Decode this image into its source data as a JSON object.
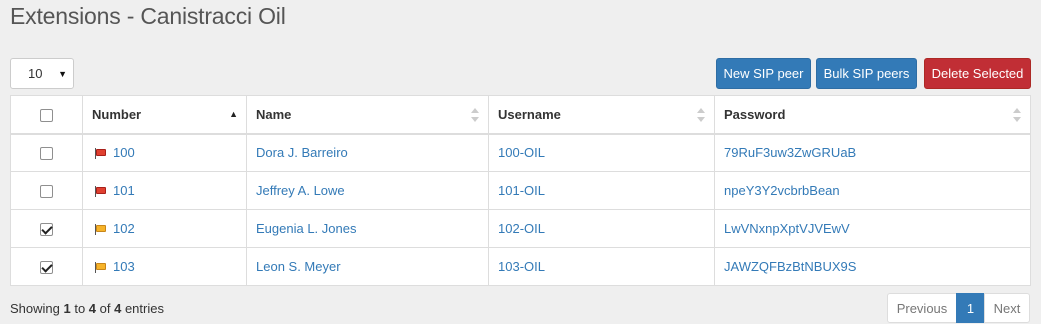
{
  "title": "Extensions - Canistracci Oil",
  "page_length": {
    "value": "10"
  },
  "toolbar": {
    "new_label": "New SIP peer",
    "bulk_label": "Bulk SIP peers",
    "delete_label": "Delete Selected"
  },
  "table": {
    "headers": {
      "number": "Number",
      "name": "Name",
      "username": "Username",
      "password": "Password"
    },
    "sort": {
      "column": "Number",
      "direction": "ascending"
    },
    "rows": [
      {
        "checked": false,
        "flag": "red",
        "number": "100",
        "name": "Dora J. Barreiro",
        "username": "100-OIL",
        "password": "79RuF3uw3ZwGRUaB"
      },
      {
        "checked": false,
        "flag": "red",
        "number": "101",
        "name": "Jeffrey A. Lowe",
        "username": "101-OIL",
        "password": "npeY3Y2vcbrbBean"
      },
      {
        "checked": true,
        "flag": "orange",
        "number": "102",
        "name": "Eugenia L. Jones",
        "username": "102-OIL",
        "password": "LwVNxnpXptVJVEwV"
      },
      {
        "checked": true,
        "flag": "orange",
        "number": "103",
        "name": "Leon S. Meyer",
        "username": "103-OIL",
        "password": "JAWZQFBzBtNBUX9S"
      }
    ]
  },
  "info": {
    "prefix": "Showing ",
    "from": "1",
    "to_word": " to ",
    "to": "4",
    "of_word": " of ",
    "total": "4",
    "suffix": " entries"
  },
  "pagination": {
    "prev": "Previous",
    "current": "1",
    "next": "Next"
  },
  "colors": {
    "primary": "#337ab7",
    "danger": "#c12e35",
    "flag_red": "#e04030",
    "flag_orange": "#f6b329"
  }
}
